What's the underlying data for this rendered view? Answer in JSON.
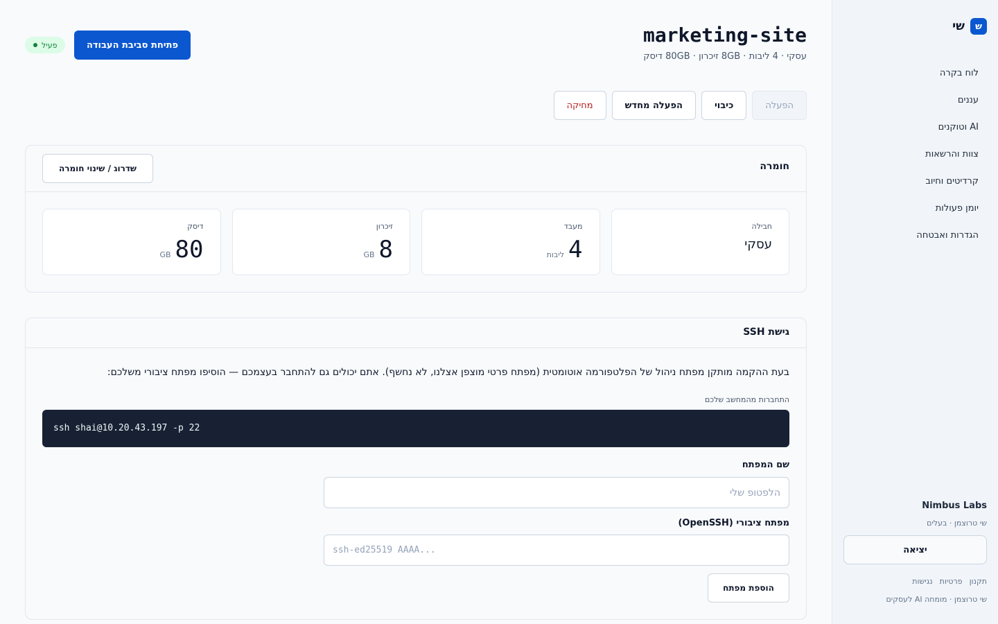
{
  "sidebar": {
    "logo_glyph": "ש",
    "brand_name": "שי",
    "nav": [
      {
        "label": "לוח בקרה"
      },
      {
        "label": "עננים"
      },
      {
        "label": "AI וטוקנים"
      },
      {
        "label": "צוות והרשאות"
      },
      {
        "label": "קרדיטים וחיוב"
      },
      {
        "label": "יומן פעולות"
      },
      {
        "label": "הגדרות ואבטחה"
      }
    ],
    "org_name": "Nimbus Labs",
    "org_user": "שי טרוצמן · בעלים",
    "logout_label": "יציאה",
    "footer_links": [
      "תקנון",
      "פרטיות",
      "נגישות"
    ],
    "footer_credit": "שי טרוצמן · מומחה AI לעסקים"
  },
  "header": {
    "title": "marketing-site",
    "subtitle": "עסקי · 4 ליבות · 8GB זיכרון · 80GB דיסק",
    "open_workspace_label": "פתיחת סביבת העבודה",
    "status_label": "פעיל"
  },
  "actions": {
    "start": "הפעלה",
    "shutdown": "כיבוי",
    "restart": "הפעלה מחדש",
    "delete": "מחיקה"
  },
  "hardware": {
    "title": "חומרה",
    "upgrade_label": "שדרוג / שינוי חומרה",
    "stats": [
      {
        "label": "חבילה",
        "value": "עסקי",
        "unit": ""
      },
      {
        "label": "מעבד",
        "value": "4",
        "unit": "ליבות"
      },
      {
        "label": "זיכרון",
        "value": "8",
        "unit": "GB"
      },
      {
        "label": "דיסק",
        "value": "80",
        "unit": "GB"
      }
    ]
  },
  "ssh": {
    "title": "גישת SSH",
    "description": "בעת ההקמה מותקן מפתח ניהול של הפלטפורמה אוטומטית (מפתח פרטי מוצפן אצלנו, לא נחשף). אתם יכולים גם להתחבר בעצמכם — הוסיפו מפתח ציבורי משלכם:",
    "connect_label": "התחברות מהמחשב שלכם",
    "command": "ssh shai@10.20.43.197 -p 22",
    "key_name_label": "שם המפתח",
    "key_name_placeholder": "הלפטופ שלי",
    "public_key_label": "מפתח ציבורי (OpenSSH)",
    "public_key_placeholder": "ssh-ed25519 AAAA...",
    "add_key_label": "הוספת מפתח"
  },
  "colors": {
    "primary": "#0b57d0",
    "danger": "#b91c1c",
    "success": "#15803d",
    "terminal_bg": "#172133"
  }
}
